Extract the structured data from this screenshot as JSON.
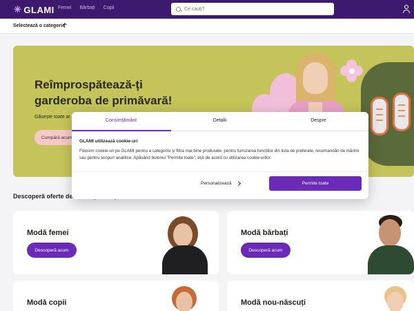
{
  "header": {
    "logo": "GLAMI",
    "nav": [
      "Femei",
      "Bărbați",
      "Copii"
    ],
    "search_placeholder": "Ce cauți?"
  },
  "category_bar": {
    "label": "Selectează o categorie"
  },
  "hero": {
    "title": "Reîmprospătează-ți garderoba de primăvară!",
    "subtitle": "Găsește toate ar",
    "button": "Cumpără acum"
  },
  "section": {
    "title": "Descoperă oferte de modă și încălțăminte"
  },
  "cards": [
    {
      "title": "Modă femei",
      "button": "Descoperă acum"
    },
    {
      "title": "Modă bărbați",
      "button": "Descoperă acum"
    },
    {
      "title": "Modă copii"
    },
    {
      "title": "Modă nou-născuți"
    }
  ],
  "consent": {
    "tabs": [
      "Consimțământ",
      "Detalii",
      "Despre"
    ],
    "active_tab": "Consimțământ",
    "heading": "GLAMI utilizează cookie-uri",
    "body": "Folosim cookie-uri pe GLAMI pentru a categorisi și filtra mai bine produsele, pentru furnizarea funcțiilor din lista de preferate, recomandări de mărimi sau pentru scopuri analitice. Apăsând butonul \"Permite toate\", ești de acord cu utilizarea cookie-urilor.",
    "customize_label": "Personalizează",
    "allow_all_label": "Permite toate"
  },
  "colors": {
    "brand": "#3d1a6e",
    "accent": "#6b2ab7",
    "hero_bg": "#c5c45a"
  }
}
